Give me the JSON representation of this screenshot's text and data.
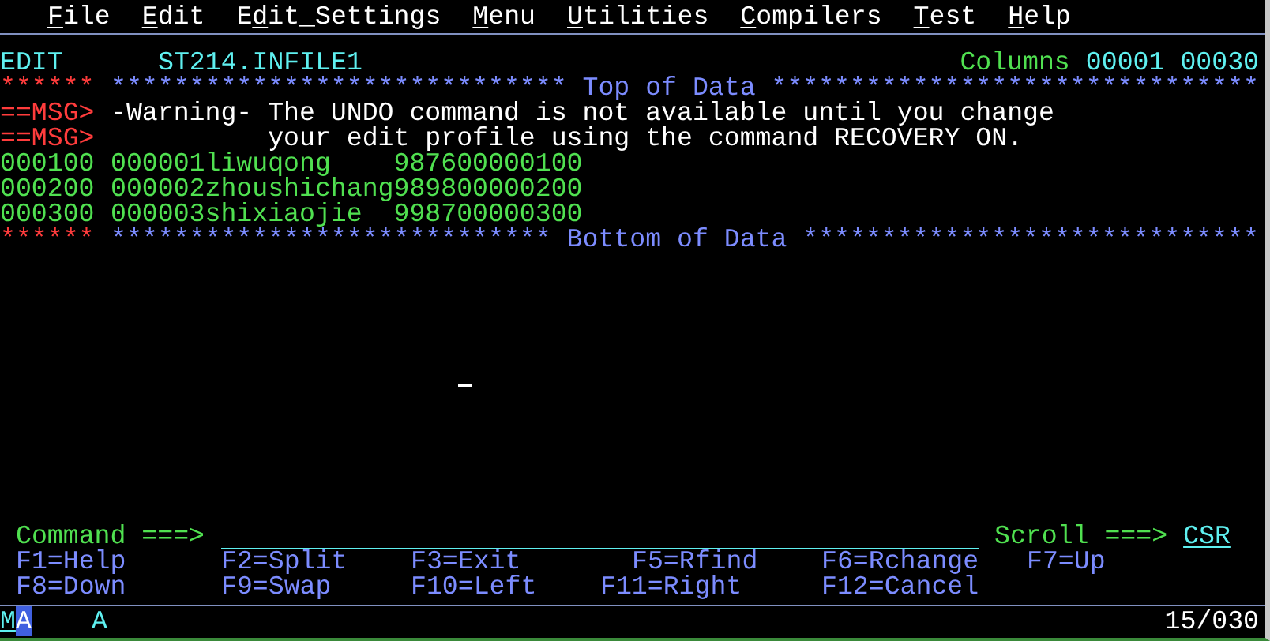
{
  "menu": [
    {
      "hotkey": "F",
      "after": "ile"
    },
    {
      "hotkey": "E",
      "after": "dit"
    },
    {
      "before": "E",
      "hotkey": "d",
      "after": "it_Settings"
    },
    {
      "hotkey": "M",
      "after": "enu"
    },
    {
      "hotkey": "U",
      "after": "tilities"
    },
    {
      "hotkey": "C",
      "after": "ompilers"
    },
    {
      "hotkey": "T",
      "after": "est"
    },
    {
      "hotkey": "H",
      "after": "elp"
    }
  ],
  "header": {
    "mode": "EDIT",
    "dataset": "ST214.INFILE1",
    "columns_label": "Columns",
    "columns_from": "00001",
    "columns_to": "00030"
  },
  "lines": [
    {
      "kind": "marker",
      "prefix": "******",
      "text": "***************************** Top of Data *******************************"
    },
    {
      "kind": "message",
      "prefix": "==MSG>",
      "text": "-Warning- The UNDO command is not available until you change"
    },
    {
      "kind": "message",
      "prefix": "==MSG>",
      "text": "          your edit profile using the command RECOVERY ON."
    },
    {
      "kind": "data",
      "prefix": "000100",
      "text": "000001liwuqong    987600000100"
    },
    {
      "kind": "data",
      "prefix": "000200",
      "text": "000002zhoushichang989800000200"
    },
    {
      "kind": "data",
      "prefix": "000300",
      "text": "000003shixiaojie  998700000300"
    },
    {
      "kind": "marker",
      "prefix": "******",
      "text": "**************************** Bottom of Data *****************************"
    }
  ],
  "command": {
    "label": "Command ===>"
  },
  "scroll": {
    "label": "Scroll ===>",
    "value": "CSR"
  },
  "function_keys": [
    [
      {
        "label": "F1=Help"
      },
      {
        "label": "F2=Split"
      },
      {
        "label": "F3=Exit"
      },
      {
        "label": "F5=Rfind"
      },
      {
        "label": "F6=Rchange"
      },
      {
        "label": "F7=Up"
      }
    ],
    [
      {
        "label": "F8=Down"
      },
      {
        "label": "F9=Swap"
      },
      {
        "label": "F10=Left"
      },
      {
        "label": "F11=Right"
      },
      {
        "label": "F12=Cancel"
      }
    ]
  ],
  "status": {
    "left": "MA",
    "mode": "A",
    "position": "15/030"
  }
}
